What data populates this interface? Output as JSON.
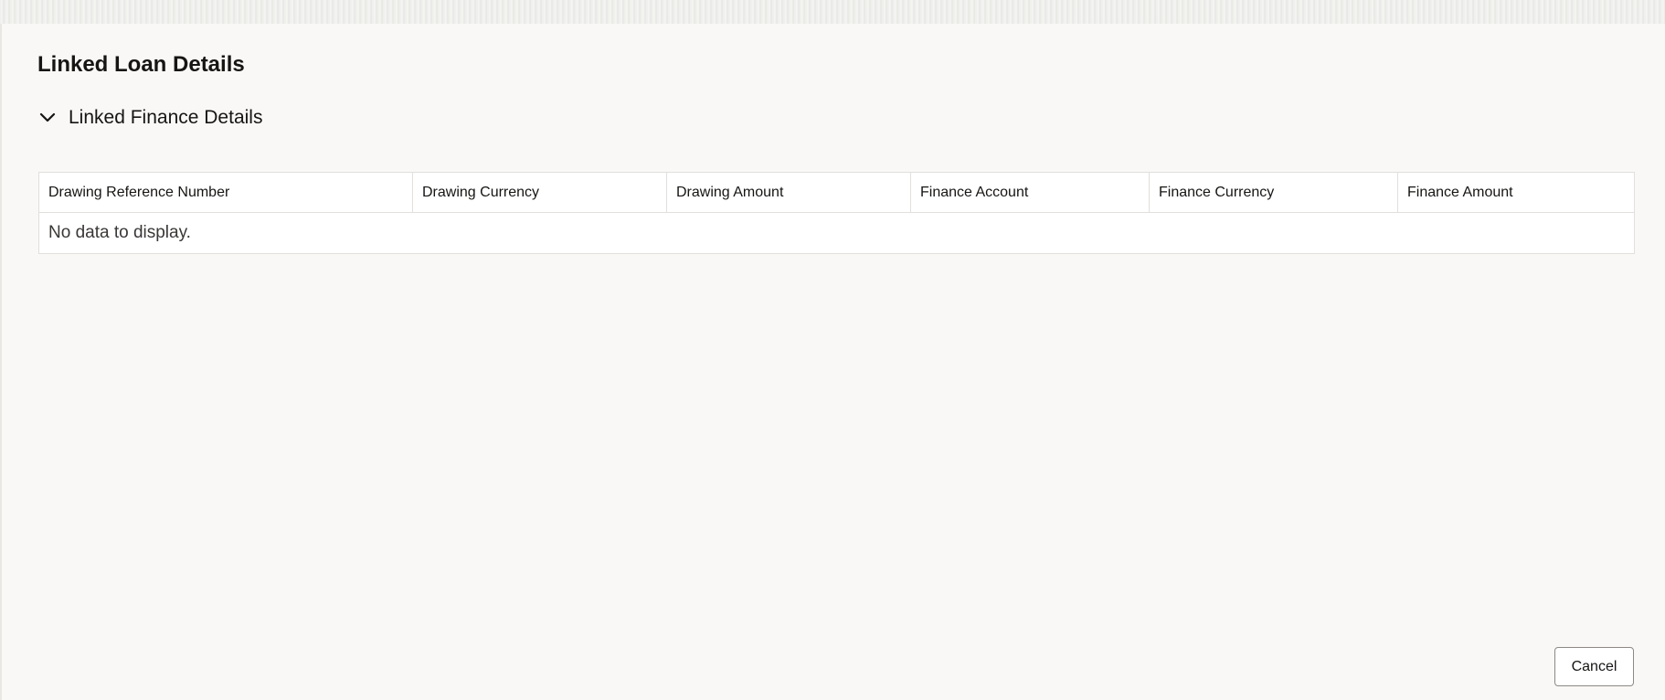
{
  "dialog": {
    "title": "Linked Loan Details",
    "section": {
      "title": "Linked Finance Details",
      "expanded": true,
      "icon": "chevron-down-icon"
    },
    "table": {
      "columns": [
        "Drawing Reference Number",
        "Drawing Currency",
        "Drawing Amount",
        "Finance Account",
        "Finance Currency",
        "Finance Amount"
      ],
      "rows": [],
      "empty_message": "No data to display."
    },
    "footer": {
      "cancel_label": "Cancel"
    }
  }
}
